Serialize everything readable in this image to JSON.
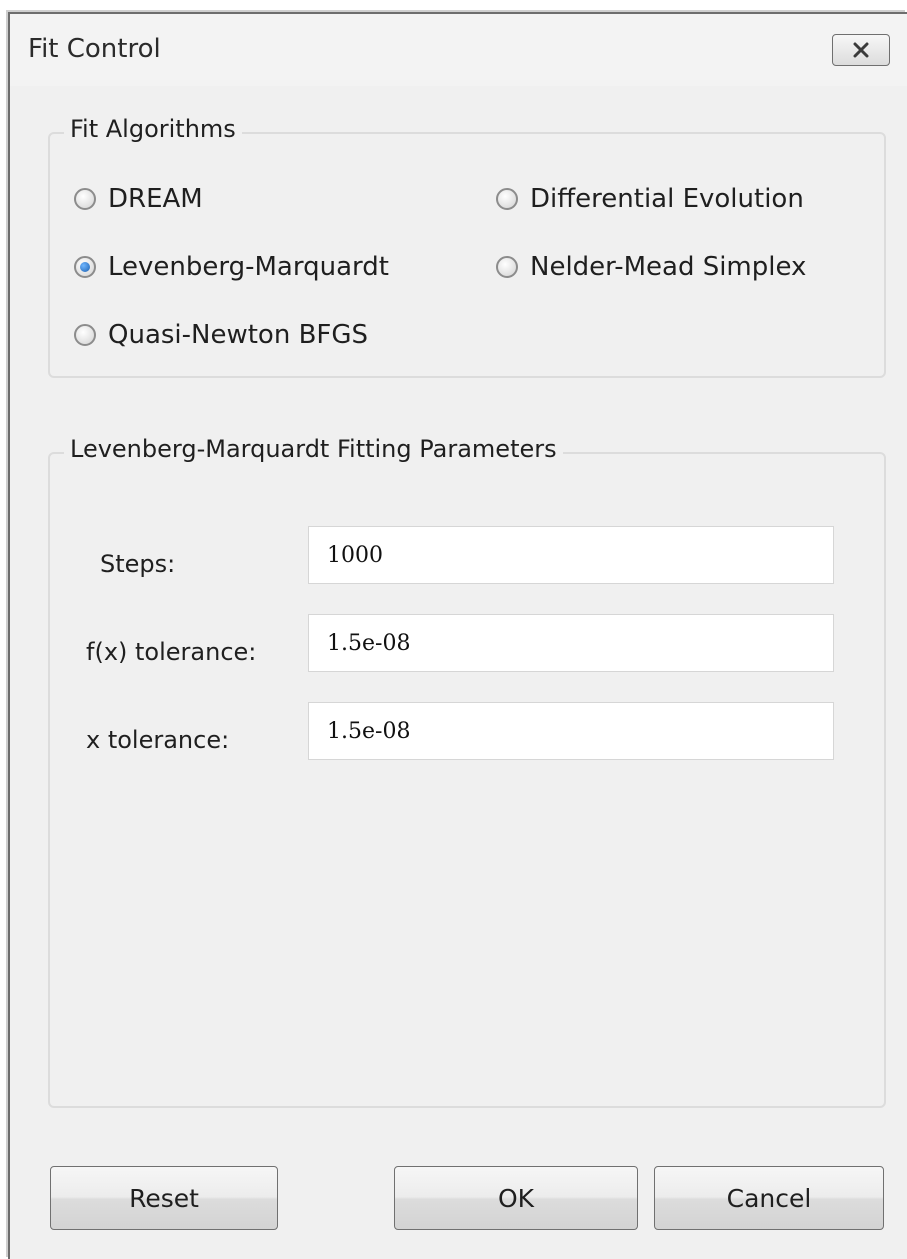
{
  "window": {
    "title": "Fit Control"
  },
  "algorithms": {
    "legend": "Fit Algorithms",
    "options": [
      {
        "label": "DREAM",
        "selected": false
      },
      {
        "label": "Differential Evolution",
        "selected": false
      },
      {
        "label": "Levenberg-Marquardt",
        "selected": true
      },
      {
        "label": "Nelder-Mead Simplex",
        "selected": false
      },
      {
        "label": "Quasi-Newton BFGS",
        "selected": false
      }
    ]
  },
  "parameters": {
    "legend": "Levenberg-Marquardt Fitting Parameters",
    "fields": [
      {
        "label": "Steps:",
        "value": "1000"
      },
      {
        "label": "f(x) tolerance:",
        "value": "1.5e-08"
      },
      {
        "label": "x tolerance:",
        "value": "1.5e-08"
      }
    ]
  },
  "buttons": {
    "reset": "Reset",
    "ok": "OK",
    "cancel": "Cancel"
  },
  "icons": {
    "close": "close-icon"
  },
  "colors": {
    "window_bg": "#f0f0f0",
    "radio_selected": "#1b5fb0"
  }
}
